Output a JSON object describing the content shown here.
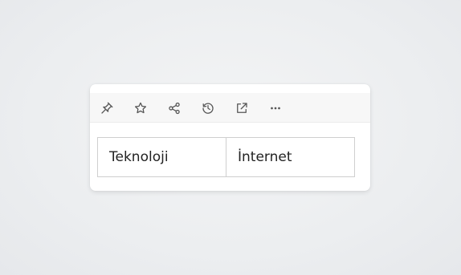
{
  "toolbar": {
    "icons": [
      "pin-icon",
      "star-icon",
      "share-icon",
      "history-icon",
      "external-link-icon",
      "more-icon"
    ]
  },
  "tags": [
    {
      "label": "Teknoloji"
    },
    {
      "label": "İnternet"
    }
  ],
  "colors": {
    "icon": "#555555",
    "toolbar_bg": "#f7f7f7",
    "border": "#cfcfcf",
    "text": "#222222"
  }
}
